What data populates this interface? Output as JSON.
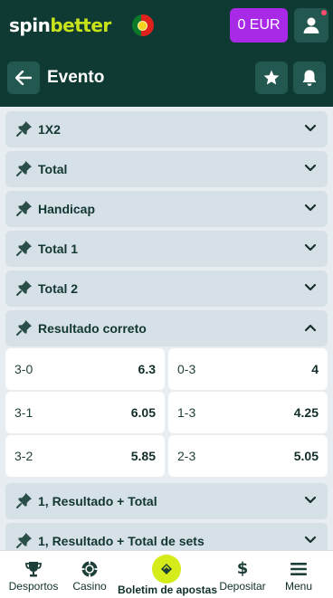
{
  "topbar": {
    "logo_part1": "spin",
    "logo_part2": "better",
    "balance": "0 EUR"
  },
  "header": {
    "title": "Evento"
  },
  "markets_top": [
    {
      "label": "1X2"
    },
    {
      "label": "Total"
    },
    {
      "label": "Handicap"
    },
    {
      "label": "Total 1"
    },
    {
      "label": "Total 2"
    }
  ],
  "expanded_market": {
    "label": "Resultado correto",
    "odds": [
      {
        "left_score": "3-0",
        "left_odd": "6.3",
        "right_score": "0-3",
        "right_odd": "4"
      },
      {
        "left_score": "3-1",
        "left_odd": "6.05",
        "right_score": "1-3",
        "right_odd": "4.25"
      },
      {
        "left_score": "3-2",
        "left_odd": "5.85",
        "right_score": "2-3",
        "right_odd": "5.05"
      }
    ]
  },
  "markets_bottom": [
    {
      "label": "1, Resultado + Total"
    },
    {
      "label": "1, Resultado + Total de sets"
    }
  ],
  "bottom_nav": {
    "sports": "Desportos",
    "casino": "Casino",
    "betslip": "Boletim de apostas",
    "deposit": "Depositar",
    "menu": "Menu"
  },
  "colors": {
    "brand_dark": "#0f3a33",
    "brand_lime": "#c9e31b",
    "balance_purple": "#a82ae6",
    "betslip_lime": "#d5ec1a"
  }
}
